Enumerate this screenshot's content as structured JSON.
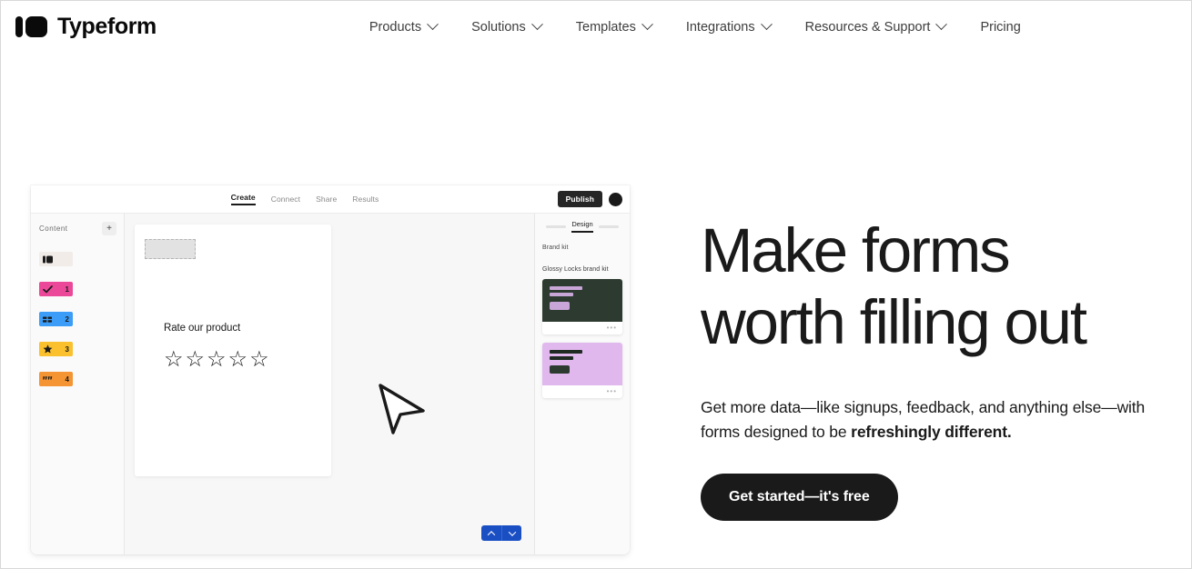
{
  "brand": {
    "name": "Typeform",
    "logo_icon": "typeform-logo-icon"
  },
  "nav": {
    "items": [
      {
        "label": "Products",
        "has_caret": true
      },
      {
        "label": "Solutions",
        "has_caret": true
      },
      {
        "label": "Templates",
        "has_caret": true
      },
      {
        "label": "Integrations",
        "has_caret": true
      },
      {
        "label": "Resources & Support",
        "has_caret": true
      },
      {
        "label": "Pricing",
        "has_caret": false
      }
    ]
  },
  "hero": {
    "title": "Make forms\nworth filling out",
    "subtitle_prefix": "Get more data—like signups, feedback, and anything else—with forms designed to be ",
    "subtitle_bold": "refreshingly different.",
    "cta_label": "Get started—it's free"
  },
  "mockup": {
    "tabs": [
      {
        "label": "Create",
        "active": true
      },
      {
        "label": "Connect",
        "active": false
      },
      {
        "label": "Share",
        "active": false
      },
      {
        "label": "Results",
        "active": false
      }
    ],
    "publish_label": "Publish",
    "avatar_icon": "user-avatar-icon",
    "sidebar": {
      "title": "Content",
      "add_label": "+",
      "items": [
        {
          "number": "",
          "icon": "welcome-screen-icon",
          "color": "#f2ece9",
          "type": "cover"
        },
        {
          "number": "1",
          "icon": "checkmark-icon",
          "color": "#ec4899",
          "type": "yes-no"
        },
        {
          "number": "2",
          "icon": "multiple-choice-icon",
          "color": "#3b9df8",
          "type": "multiple-choice"
        },
        {
          "number": "3",
          "icon": "star-rating-icon",
          "color": "#fbc02d",
          "type": "rating"
        },
        {
          "number": "4",
          "icon": "quote-icon",
          "color": "#f59432",
          "type": "long-text"
        }
      ]
    },
    "canvas": {
      "image_placeholder_icon": "image-placeholder-icon",
      "question": "Rate our product",
      "stars": [
        "☆",
        "☆",
        "☆",
        "☆",
        "☆"
      ],
      "cursor_icon": "cursor-pointer-icon",
      "nav_up_icon": "chevron-up-icon",
      "nav_down_icon": "chevron-down-icon",
      "nav_color": "#1a4fc4"
    },
    "design_panel": {
      "tab_label": "Design",
      "section_label": "Brand kit",
      "kit_label": "Glossy Locks brand kit",
      "themes": [
        {
          "name": "dark-green-theme",
          "bg": "#2c3a30",
          "line_color": "#c9a6d8",
          "button_color": "#c9a6d8",
          "menu_icon": "ellipsis-icon"
        },
        {
          "name": "lavender-theme",
          "bg": "#e0b8ee",
          "line_color": "#1e2a22",
          "button_color": "#2c3a30",
          "menu_icon": "ellipsis-icon"
        }
      ]
    }
  }
}
